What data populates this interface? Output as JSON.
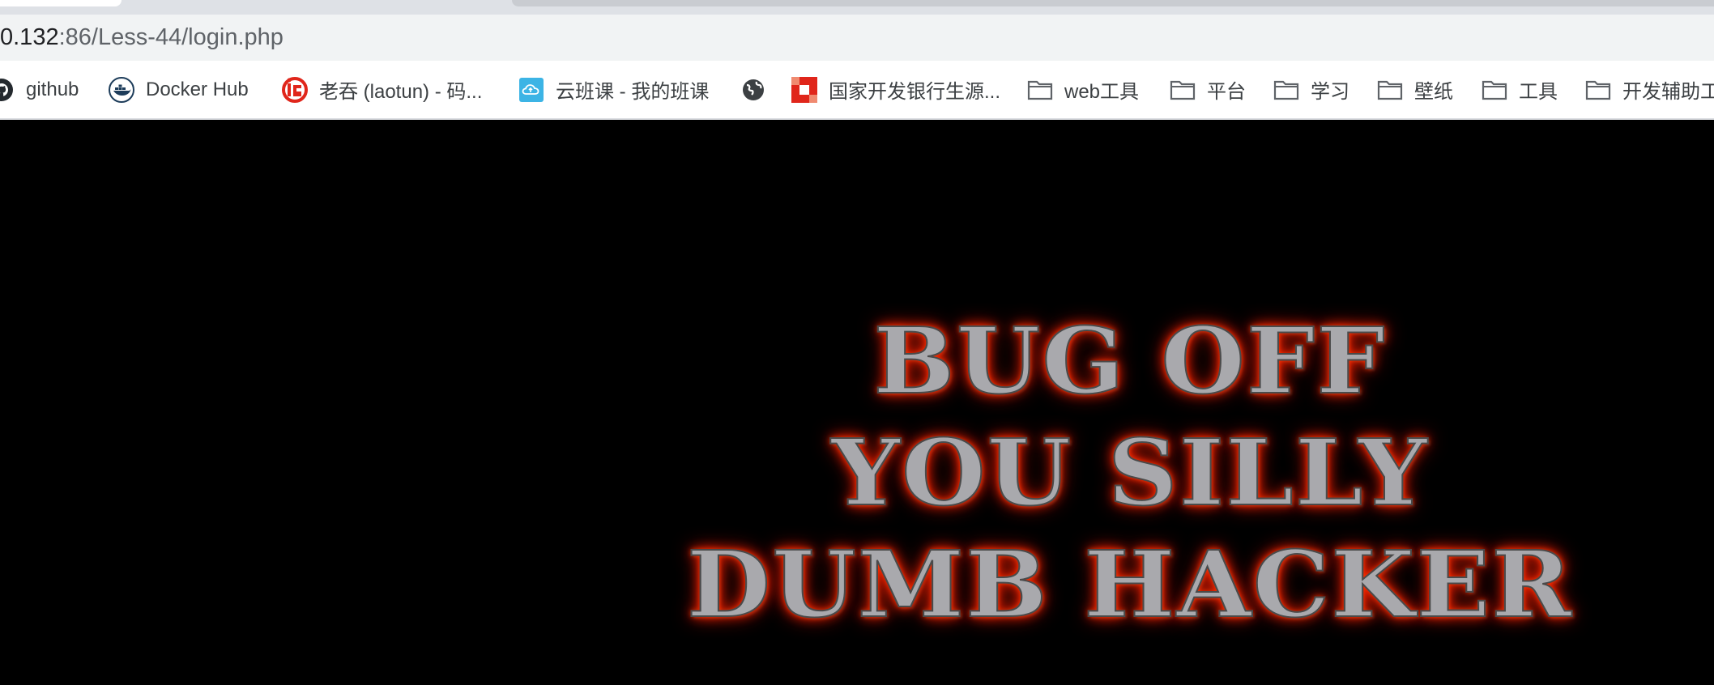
{
  "address_bar": {
    "host_partial": "0.132",
    "path": ":86/Less-44/login.php"
  },
  "bookmarks": [
    {
      "label": "github",
      "icon": "github-icon"
    },
    {
      "label": "Docker Hub",
      "icon": "docker-icon"
    },
    {
      "label": "老吞 (laotun) - 码...",
      "icon": "laotun-icon"
    },
    {
      "label": "云班课 - 我的班课",
      "icon": "cloud-class-icon"
    },
    {
      "label": "",
      "icon": "globe-icon"
    },
    {
      "label": "国家开发银行生源...",
      "icon": "cdb-icon"
    },
    {
      "label": "web工具",
      "icon": "folder-icon"
    },
    {
      "label": "平台",
      "icon": "folder-icon"
    },
    {
      "label": "学习",
      "icon": "folder-icon"
    },
    {
      "label": "壁纸",
      "icon": "folder-icon"
    },
    {
      "label": "工具",
      "icon": "folder-icon"
    },
    {
      "label": "开发辅助工",
      "icon": "folder-icon"
    }
  ],
  "page": {
    "message_lines": [
      "BUG OFF",
      "YOU SILLY",
      "DUMB HACKER"
    ]
  },
  "colors": {
    "background": "#000000",
    "glow": "#ff2200",
    "text": "#a9a9ad",
    "docker": "#1d3c5a",
    "laotun": "#e0261b",
    "cloud": "#3cb4e5",
    "cdb": "#e0261b"
  }
}
